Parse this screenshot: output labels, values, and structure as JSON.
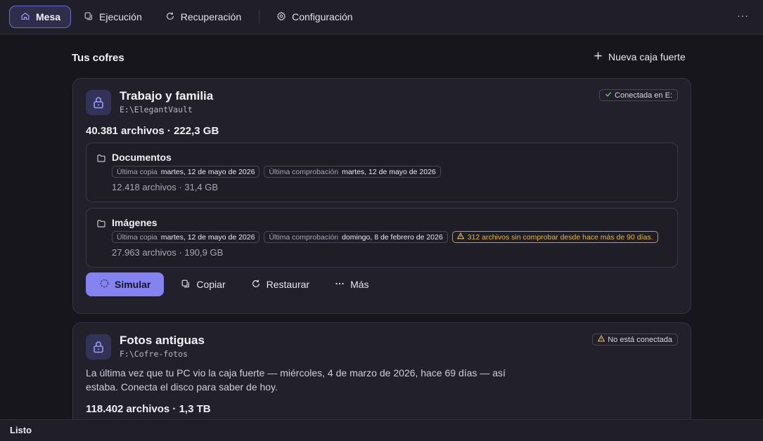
{
  "nav": {
    "items": [
      {
        "label": "Mesa",
        "icon": "home-icon"
      },
      {
        "label": "Ejecución",
        "icon": "copy-icon"
      },
      {
        "label": "Recuperación",
        "icon": "refresh-icon"
      },
      {
        "label": "Configuración",
        "icon": "settings-icon"
      }
    ],
    "more_label": "···"
  },
  "main": {
    "section_title": "Tus cofres",
    "new_vault_label": "Nueva caja fuerte"
  },
  "vaults": [
    {
      "name": "Trabajo y familia",
      "path": "E:\\ElegantVault",
      "status": "Conectada en E:",
      "stats": "40.381 archivos · 222,3 GB",
      "folders": [
        {
          "name": "Documentos",
          "chips": [
            {
              "key": "Última copia",
              "value": "martes, 12 de mayo de 2026"
            },
            {
              "key": "Última comprobación",
              "value": "martes, 12 de mayo de 2026"
            }
          ],
          "meta": "12.418 archivos · 31,4 GB"
        },
        {
          "name": "Imágenes",
          "chips": [
            {
              "key": "Última copia",
              "value": "martes, 12 de mayo de 2026"
            },
            {
              "key": "Última comprobación",
              "value": "domingo, 8 de febrero de 2026"
            }
          ],
          "warning": "312 archivos sin comprobar desde hace más de 90 días.",
          "meta": "27.963 archivos · 190,9 GB"
        }
      ],
      "actions": {
        "simulate": "Simular",
        "copy": "Copiar",
        "restore": "Restaurar",
        "more": "Más"
      }
    },
    {
      "name": "Fotos antiguas",
      "path": "F:\\Cofre-fotos",
      "status": "No está conectada",
      "description": "La última vez que tu PC vio la caja fuerte — miércoles, 4 de marzo de 2026, hace 69 días — así estaba. Conecta el disco para saber de hoy.",
      "stats": "118.402 archivos · 1,3 TB"
    }
  ],
  "statusbar": {
    "text": "Listo"
  },
  "colors": {
    "accent": "#8483f0",
    "warning": "#e8b540",
    "success": "#4cc46a"
  }
}
